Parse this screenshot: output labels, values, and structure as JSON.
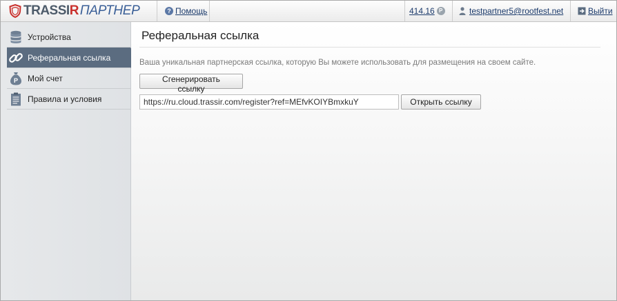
{
  "header": {
    "logo_brand_prefix": "TRASSI",
    "logo_brand_r": "R",
    "logo_partner": "ПАРТНЕР",
    "help_label": "Помощь",
    "balance": "414.16",
    "balance_icon_glyph": "P",
    "user_email": "testpartner5@rootfest.net",
    "logout_label": "Выйти"
  },
  "sidebar": {
    "items": [
      {
        "label": "Устройства",
        "icon": "database-icon",
        "active": false
      },
      {
        "label": "Реферальная ссылка",
        "icon": "link-icon",
        "active": true
      },
      {
        "label": "Мой счет",
        "icon": "money-bag-icon",
        "active": false
      },
      {
        "label": "Правила и условия",
        "icon": "document-icon",
        "active": false
      }
    ]
  },
  "main": {
    "title": "Реферальная ссылка",
    "description": "Ваша уникальная партнерская ссылка, которую Вы можете использовать для размещения на своем сайте.",
    "generate_button": "Сгенерировать ссылку",
    "referral_url": "https://ru.cloud.trassir.com/register?ref=MEfvKOIYBmxkuY",
    "open_button": "Открыть ссылку"
  },
  "colors": {
    "active_nav": "#5b6c80",
    "link": "#1b3a6b",
    "brand_red": "#c9302c",
    "brand_blue": "#3a5f97"
  }
}
